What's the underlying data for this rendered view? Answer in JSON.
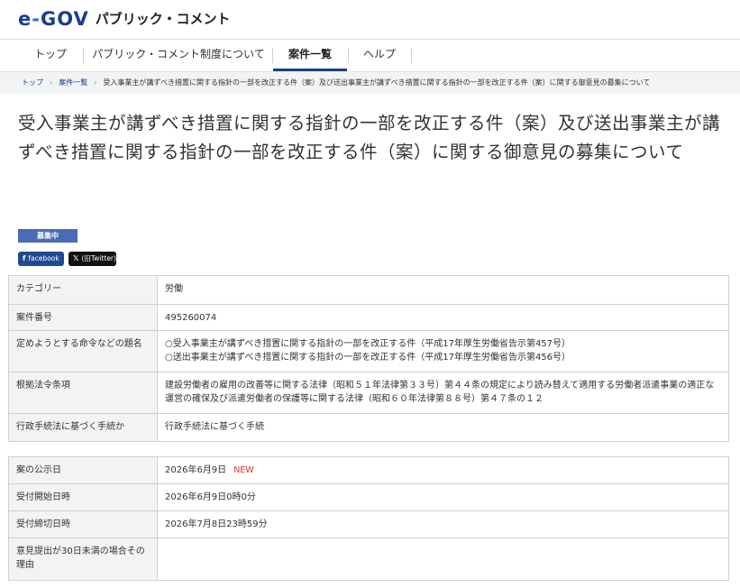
{
  "header": {
    "logo_main": "e-GOV",
    "logo_sub": "パブリック・コメント"
  },
  "nav": {
    "items": [
      {
        "label": "トップ"
      },
      {
        "label": "パブリック・コメント制度について"
      },
      {
        "label": "案件一覧"
      },
      {
        "label": "ヘルプ"
      }
    ],
    "active": "案件一覧"
  },
  "breadcrumb": {
    "items": [
      "トップ",
      "案件一覧"
    ],
    "current": "受入事業主が講ずべき措置に関する指針の一部を改正する件（案）及び送出事業主が講ずべき措置に関する指針の一部を改正する件（案）に関する御意見の募集について"
  },
  "page": {
    "title": "受入事業主が講ずべき措置に関する指針の一部を改正する件（案）及び送出事業主が講ずべき措置に関する指針の一部を改正する件（案）に関する御意見の募集について",
    "status": "募集中",
    "share_facebook": "facebook",
    "share_x": "(旧Twitter)"
  },
  "info_table_1": [
    {
      "label": "カテゴリー",
      "value": "労働"
    },
    {
      "label": "案件番号",
      "value": "495260074"
    },
    {
      "label": "定めようとする命令などの題名",
      "value_lines": [
        "○受入事業主が講ずべき措置に関する指針の一部を改正する件（平成17年厚生労働省告示第457号）",
        "○送出事業主が講ずべき措置に関する指針の一部を改正する件（平成17年厚生労働省告示第456号）"
      ]
    },
    {
      "label": "根拠法令条項",
      "value": "建設労働者の雇用の改善等に関する法律（昭和５１年法律第３３号）第４４条の規定により読み替えて適用する労働者派遣事業の適正な運営の確保及び派遣労働者の保護等に関する法律（昭和６０年法律第８８号）第４７条の１２"
    },
    {
      "label": "行政手続法に基づく手続か",
      "value": "行政手続法に基づく手続"
    }
  ],
  "info_table_2": [
    {
      "label": "案の公示日",
      "value": "2026年6月9日",
      "badge": "NEW"
    },
    {
      "label": "受付開始日時",
      "value": "2026年6月9日0時0分"
    },
    {
      "label": "受付締切日時",
      "value": "2026年7月8日23時59分"
    },
    {
      "label": "意見提出が30日未満の場合その理由",
      "value": ""
    }
  ],
  "colors": {
    "brand": "#1b3c8f",
    "status_badge": "#4a6cb7",
    "new_badge": "#d9352b",
    "label_bg": "#f2f3f5"
  }
}
